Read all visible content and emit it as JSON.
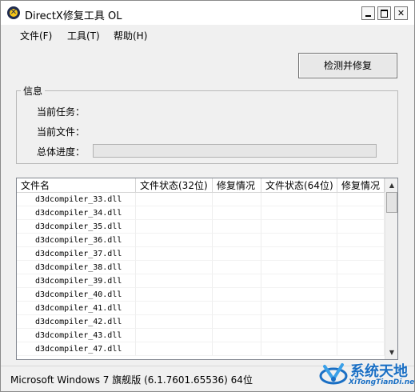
{
  "window": {
    "title": "DirectX修复工具 OL"
  },
  "menu": [
    {
      "label": "文件(F)"
    },
    {
      "label": "工具(T)"
    },
    {
      "label": "帮助(H)"
    }
  ],
  "actions": {
    "fix_button": "检测并修复"
  },
  "info": {
    "group_title": "信息",
    "current_task_label": "当前任务：",
    "current_file_label": "当前文件：",
    "overall_progress_label": "总体进度：",
    "overall_progress_value": 0
  },
  "table": {
    "columns": [
      "文件名",
      "文件状态(32位)",
      "修复情况",
      "文件状态(64位)",
      "修复情况"
    ],
    "rows": [
      {
        "name": "d3dcompiler_33.dll"
      },
      {
        "name": "d3dcompiler_34.dll"
      },
      {
        "name": "d3dcompiler_35.dll"
      },
      {
        "name": "d3dcompiler_36.dll"
      },
      {
        "name": "d3dcompiler_37.dll"
      },
      {
        "name": "d3dcompiler_38.dll"
      },
      {
        "name": "d3dcompiler_39.dll"
      },
      {
        "name": "d3dcompiler_40.dll"
      },
      {
        "name": "d3dcompiler_41.dll"
      },
      {
        "name": "d3dcompiler_42.dll"
      },
      {
        "name": "d3dcompiler_43.dll"
      },
      {
        "name": "d3dcompiler_47.dll"
      }
    ]
  },
  "status_bar": {
    "text": "Microsoft Windows 7 旗舰版 (6.1.7601.65536) 64位"
  },
  "watermark": {
    "main": "系统天地",
    "sub": "XiTongTianDi.net",
    "color": "#1a6fc4"
  },
  "icons": {
    "app": "directx-logo-icon",
    "minimize": "minimize-icon",
    "maximize": "maximize-icon",
    "close": "close-icon",
    "scroll_up": "chevron-up-icon",
    "scroll_down": "chevron-down-icon"
  }
}
